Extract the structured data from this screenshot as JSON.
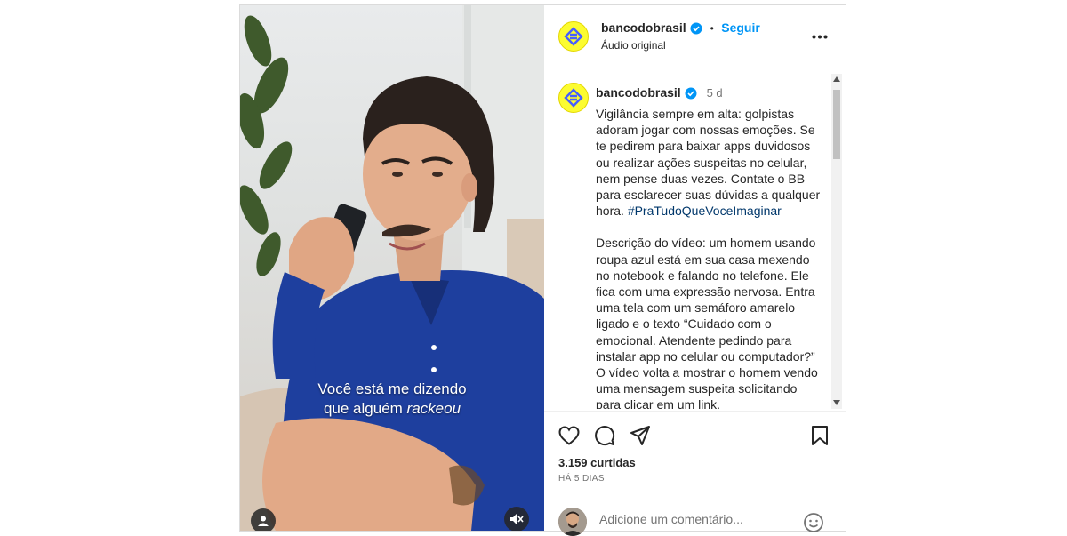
{
  "account": {
    "username": "bancodobrasil",
    "follow_label": "Seguir",
    "separator": "•",
    "audio_label": "Áudio original"
  },
  "video": {
    "caption_line1": "Você está me dizendo",
    "caption_line2_start": "que alguém ",
    "caption_line2_italic": "rackeou",
    "caption_line2_end": ""
  },
  "post": {
    "time_ago": "5 d",
    "caption_main": "Vigilância sempre em alta: golpistas adoram jogar com nossas emoções. Se te pedirem para baixar apps duvidosos ou realizar ações suspeitas no celular, nem pense duas vezes. Contate o BB para esclarecer suas dúvidas a qualquer hora.",
    "hashtag": "#PraTudoQueVoceImaginar",
    "description": "Descrição do vídeo: um homem usando roupa azul está em sua casa mexendo no notebook e falando no telefone. Ele fica com uma expressão nervosa. Entra uma tela com um semáforo amarelo ligado e o texto “Cuidado com o emocional. Atendente pedindo para instalar app no celular ou computador?” O vídeo volta a mostrar o homem vendo uma mensagem suspeita solicitando para clicar em um link."
  },
  "stats": {
    "likes": "3.159 curtidas",
    "posted": "HÁ 5 DIAS"
  },
  "comment": {
    "placeholder": "Adicione um comentário..."
  },
  "colors": {
    "accent": "#0095f6",
    "brand_yellow": "#fcfc30",
    "brand_blue": "#465eff",
    "shirt_blue": "#1e3f9e"
  },
  "icons": [
    "verified-badge-icon",
    "more-options-icon",
    "heart-icon",
    "comment-icon",
    "share-icon",
    "bookmark-icon",
    "emoji-icon",
    "user-tag-icon",
    "mute-icon",
    "bb-logo-icon"
  ]
}
